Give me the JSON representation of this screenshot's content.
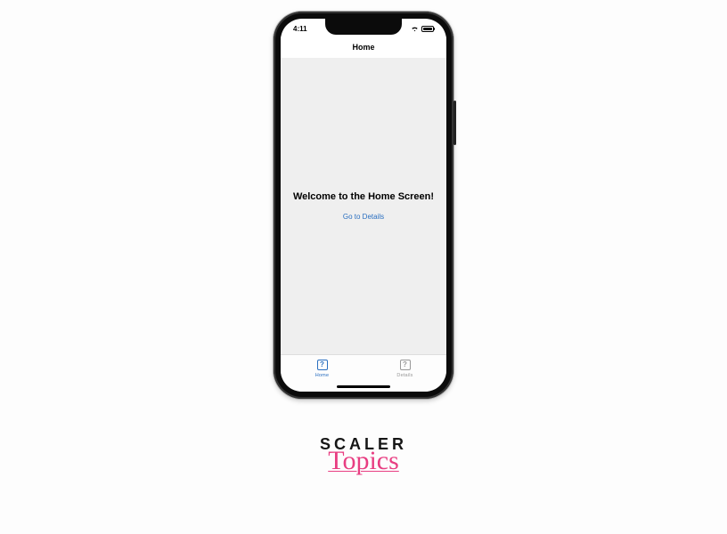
{
  "status": {
    "time": "4:11"
  },
  "header": {
    "title": "Home"
  },
  "content": {
    "welcome": "Welcome to the Home Screen!",
    "link": "Go to Details"
  },
  "tabs": {
    "home": {
      "label": "Home",
      "glyph": "?"
    },
    "details": {
      "label": "Details",
      "glyph": "?"
    }
  },
  "branding": {
    "main": "SCALER",
    "sub": "Topics"
  }
}
